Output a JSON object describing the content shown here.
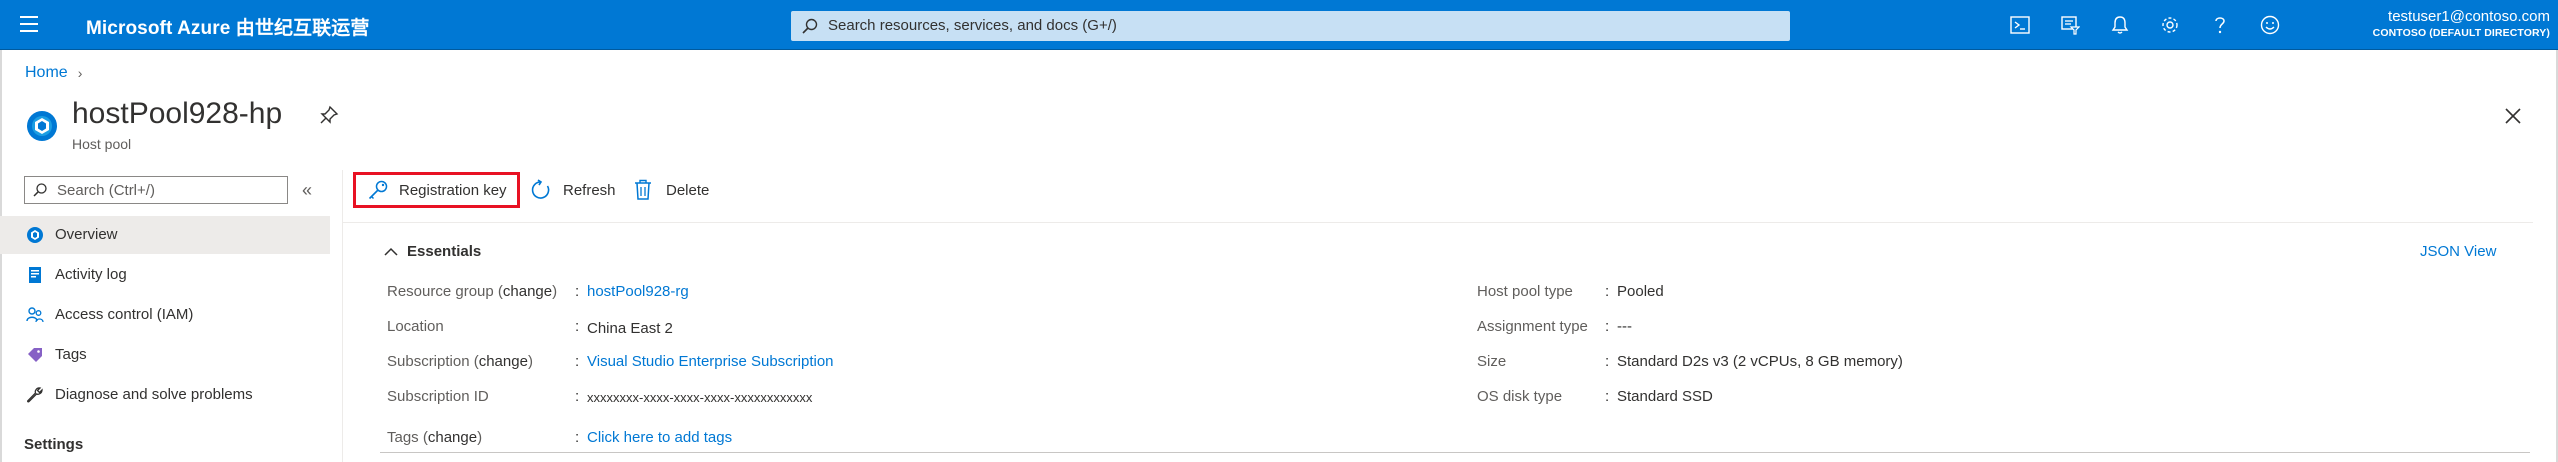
{
  "topbar": {
    "brand": "Microsoft Azure 由世纪互联运营",
    "search_placeholder": "Search resources, services, and docs (G+/)",
    "user_name": "testuser1@contoso.com",
    "user_directory": "CONTOSO (DEFAULT DIRECTORY)",
    "icons": [
      "cloud-shell-icon",
      "directory-filter-icon",
      "notifications-icon",
      "settings-icon",
      "help-icon",
      "feedback-icon"
    ],
    "bg_color": "#0078d4"
  },
  "breadcrumb": {
    "home": "Home"
  },
  "resource": {
    "title": "hostPool928-hp",
    "subtitle": "Host pool"
  },
  "sidebar": {
    "search_placeholder": "Search (Ctrl+/)",
    "items": [
      {
        "label": "Overview",
        "icon": "overview-icon",
        "active": true
      },
      {
        "label": "Activity log",
        "icon": "activity-log-icon",
        "active": false
      },
      {
        "label": "Access control (IAM)",
        "icon": "iam-icon",
        "active": false
      },
      {
        "label": "Tags",
        "icon": "tag-icon",
        "active": false
      },
      {
        "label": "Diagnose and solve problems",
        "icon": "wrench-icon",
        "active": false
      }
    ],
    "section_header": "Settings"
  },
  "commands": {
    "registration_key": "Registration key",
    "refresh": "Refresh",
    "delete": "Delete"
  },
  "essentials": {
    "header": "Essentials",
    "json_view": "JSON View",
    "change": "change",
    "left": [
      {
        "label": "Resource group",
        "has_change": true,
        "value": "hostPool928-rg",
        "is_link": true
      },
      {
        "label": "Location",
        "has_change": false,
        "value": "China East 2",
        "is_link": false
      },
      {
        "label": "Subscription",
        "has_change": true,
        "value": "Visual Studio Enterprise Subscription",
        "is_link": true
      },
      {
        "label": "Subscription ID",
        "has_change": false,
        "value": "xxxxxxxx-xxxx-xxxx-xxxx-xxxxxxxxxxxx",
        "is_link": false
      }
    ],
    "tags": {
      "label": "Tags",
      "value": "Click here to add tags"
    },
    "right": [
      {
        "label": "Host pool type",
        "value": "Pooled"
      },
      {
        "label": "Assignment type",
        "value": "---"
      },
      {
        "label": "Size",
        "value": "Standard D2s v3 (2 vCPUs, 8 GB memory)"
      },
      {
        "label": "OS disk type",
        "value": "Standard SSD"
      }
    ]
  },
  "colors": {
    "accent": "#0078d4",
    "highlight_border": "#e81123"
  }
}
